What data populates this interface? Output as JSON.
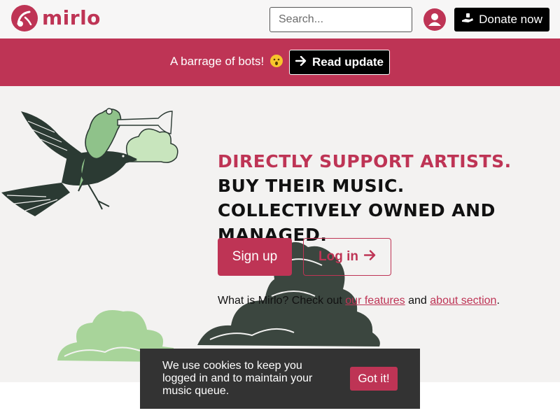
{
  "header": {
    "logo_text": "mirlo",
    "search_placeholder": "Search...",
    "donate_label": "Donate now"
  },
  "banner": {
    "text": "A barrage of bots!",
    "button_label": "Read update"
  },
  "hero": {
    "headline_accent": "Directly support artists.",
    "headline_rest": " Buy their music. Collectively owned and managed.",
    "signup_label": "Sign up",
    "login_label": "Log in",
    "whatis_prefix": "What is Mirlo? Check out ",
    "features_link": "our features",
    "whatis_mid": " and ",
    "about_link": "about section",
    "whatis_suffix": "."
  },
  "cookie": {
    "text": "We use cookies to keep you logged in and to maintain your music queue.",
    "button_label": "Got it!"
  },
  "colors": {
    "brand": "#be3455",
    "banner_bg": "#be3455",
    "hero_bg": "#f3f2f1",
    "bird": "#2b3a33",
    "frog": "#8fc28a",
    "cookie_bg": "#333333"
  },
  "icons": [
    "mirlo-logo-icon",
    "user-icon",
    "donate-hand-icon",
    "surprised-emoji-icon",
    "arrow-right-icon"
  ]
}
